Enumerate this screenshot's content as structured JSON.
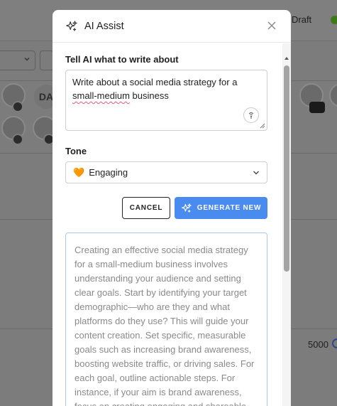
{
  "background": {
    "status_label": "Draft",
    "avatar_initials": "DA",
    "counter_value": "5000"
  },
  "modal": {
    "title": "AI Assist",
    "prompt_label": "Tell AI what to write about",
    "prompt_line1": "Write about a social media strategy for a",
    "prompt_misspelled": "small-medium",
    "prompt_line2_rest": " business",
    "tone_label": "Tone",
    "tone_emoji": "🧡",
    "tone_value": "Engaging",
    "cancel_label": "CANCEL",
    "generate_label": "GENERATE NEW",
    "result_text": "Creating an effective social media strategy for a small-medium business involves understanding your audience and setting clear goals. Start by identifying your target demographic—who are they and what platforms do they use? This will guide your content creation. Set specific, measurable goals such as increasing brand awareness, boosting website traffic, or driving sales. For each goal, outline actionable steps. For instance, if your aim is brand awareness, focus on creating engaging and shareable content that tells your brand's story. Content"
  },
  "colors": {
    "accent": "#4a8bf0",
    "overlay": "#7c7c7c",
    "result_border": "#a9c6f1"
  },
  "icons": {
    "header": "sparkle-icon",
    "close": "close-icon",
    "mic": "microphone-icon",
    "tone_chevron": "chevron-down-icon",
    "generate": "sparkle-icon"
  }
}
